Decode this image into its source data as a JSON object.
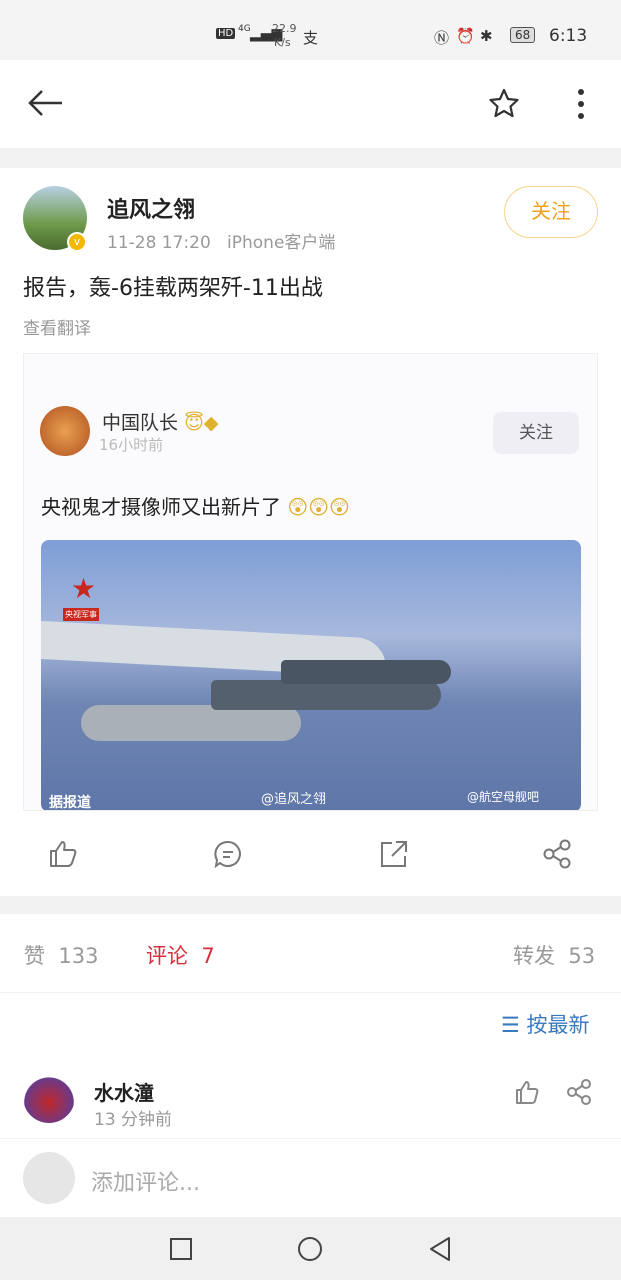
{
  "status_bar": {
    "hd": "HD",
    "network": "4G",
    "speed_value": "22.9",
    "speed_unit": "K/s",
    "battery": "68",
    "time": "6:13"
  },
  "nav": {
    "back_icon": "arrow-left-icon",
    "star_icon": "star-icon",
    "more_icon": "more-vertical-icon"
  },
  "post": {
    "author": "追风之翎",
    "time": "11-28 17:20",
    "source": "iPhone客户端",
    "follow": "关注",
    "text": "报告，轰-6挂载两架歼-11出战",
    "translate": "查看翻译",
    "embedded": {
      "author": "中国队长",
      "time": "16小时前",
      "follow": "关注",
      "text": "央视鬼才摄像师又出新片了",
      "image_logo": "央视军事",
      "image_caption": "据报道",
      "watermark1": "@追风之翎",
      "watermark2": "@航空母舰吧"
    }
  },
  "stats": {
    "like_label": "赞",
    "like_count": "133",
    "comment_label": "评论",
    "comment_count": "7",
    "repost_label": "转发",
    "repost_count": "53",
    "comment_color": "#d6303a"
  },
  "sort": {
    "label": "按最新",
    "color": "#3a7bbf"
  },
  "comments": [
    {
      "author": "水水潼",
      "time": "13 分钟前"
    }
  ],
  "add_comment": {
    "placeholder": "添加评论..."
  },
  "colors": {
    "follow": "#f0a020"
  }
}
